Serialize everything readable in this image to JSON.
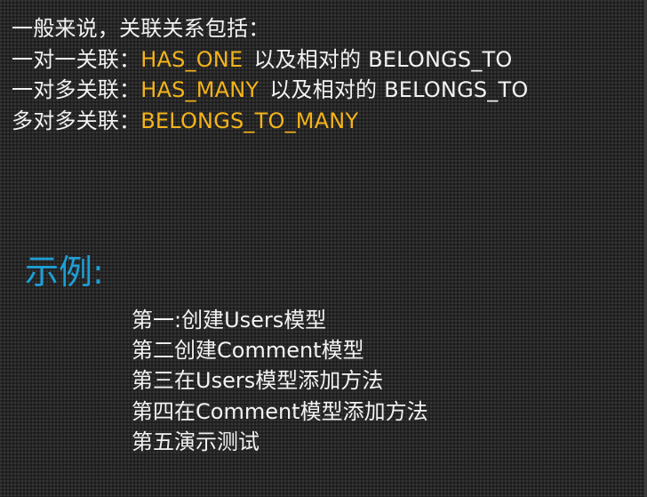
{
  "intro": {
    "heading": "一般来说，关联关系包括：",
    "lines": [
      {
        "prefix": "一对一关联：",
        "keyword": "HAS_ONE",
        "suffix": "以及相对的 BELONGS_TO"
      },
      {
        "prefix": "一对多关联：",
        "keyword": "HAS_MANY",
        "suffix": "以及相对的 BELONGS_TO"
      },
      {
        "prefix": "多对多关联：",
        "keyword": "BELONGS_TO_MANY",
        "suffix": ""
      }
    ]
  },
  "example": {
    "title": "示例:",
    "steps": [
      "第一:创建Users模型",
      "第二创建Comment模型",
      "第三在Users模型添加方法",
      "第四在Comment模型添加方法",
      "第五演示测试"
    ]
  },
  "colors": {
    "background": "#242424",
    "text": "#f2f2f2",
    "keyword": "#f4b41a",
    "title": "#1e9fd6"
  }
}
